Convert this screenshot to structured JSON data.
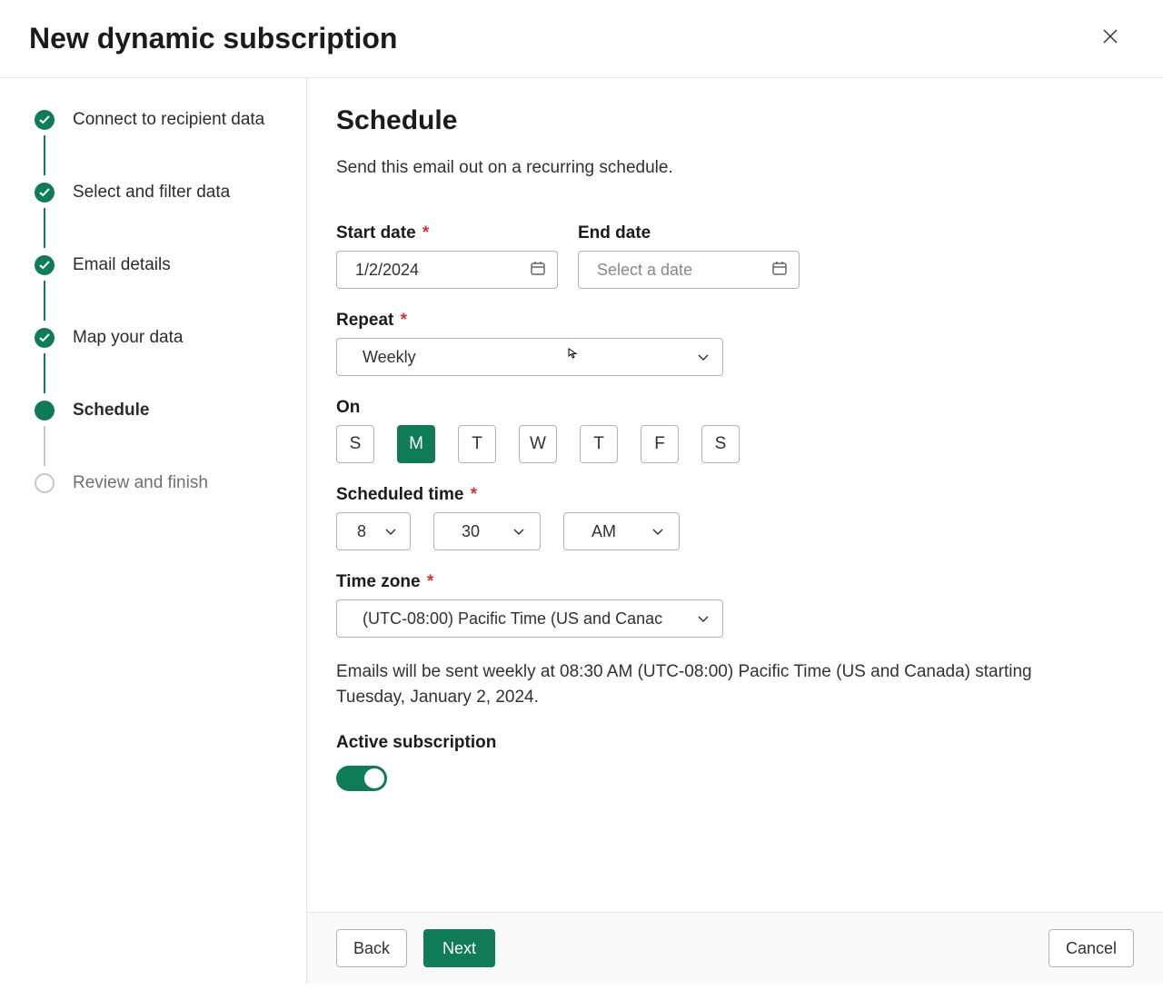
{
  "header": {
    "title": "New dynamic subscription"
  },
  "steps": [
    {
      "label": "Connect to recipient data"
    },
    {
      "label": "Select and filter data"
    },
    {
      "label": "Email details"
    },
    {
      "label": "Map your data"
    },
    {
      "label": "Schedule"
    },
    {
      "label": "Review and finish"
    }
  ],
  "schedule": {
    "heading": "Schedule",
    "description": "Send this email out on a recurring schedule.",
    "start_date_label": "Start date",
    "start_date_value": "1/2/2024",
    "end_date_label": "End date",
    "end_date_placeholder": "Select a date",
    "repeat_label": "Repeat",
    "repeat_value": "Weekly",
    "on_label": "On",
    "days": [
      "S",
      "M",
      "T",
      "W",
      "T",
      "F",
      "S"
    ],
    "days_selected_index": 1,
    "scheduled_time_label": "Scheduled time",
    "hour": "8",
    "minute": "30",
    "ampm": "AM",
    "timezone_label": "Time zone",
    "timezone_value": "(UTC-08:00) Pacific Time (US and Canac",
    "summary": "Emails will be sent weekly at 08:30 AM (UTC-08:00) Pacific Time (US and Canada) starting Tuesday, January 2, 2024.",
    "active_label": "Active subscription",
    "active": true
  },
  "footer": {
    "back": "Back",
    "next": "Next",
    "cancel": "Cancel"
  },
  "required_mark": "*"
}
